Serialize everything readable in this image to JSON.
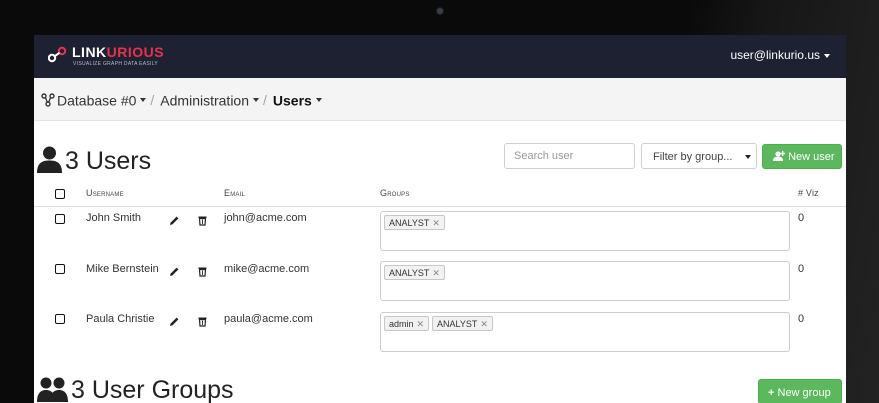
{
  "app": {
    "logo_main": "LINK",
    "logo_accent": "URIOUS",
    "logo_tagline": "VISUALIZE GRAPH DATA EASILY",
    "user_email": "user@linkurio.us"
  },
  "breadcrumb": {
    "database": "Database #0",
    "section": "Administration",
    "page": "Users",
    "separator": "/"
  },
  "users_section": {
    "title": "3 Users",
    "search_placeholder": "Search user",
    "filter_label": "Filter by group...",
    "new_user_label": "New user"
  },
  "table": {
    "headers": {
      "username": "Username",
      "email": "Email",
      "groups": "Groups",
      "viz": "# Viz"
    },
    "rows": [
      {
        "username": "John Smith",
        "email": "john@acme.com",
        "groups": [
          "ANALYST"
        ],
        "viz": "0"
      },
      {
        "username": "Mike Bernstein",
        "email": "mike@acme.com",
        "groups": [
          "ANALYST"
        ],
        "viz": "0"
      },
      {
        "username": "Paula Christie",
        "email": "paula@acme.com",
        "groups": [
          "admin",
          "ANALYST"
        ],
        "viz": "0"
      }
    ]
  },
  "groups_section": {
    "title": "3 User Groups",
    "new_group_label": "New group"
  },
  "colors": {
    "topbar": "#1e2132",
    "brand_accent": "#e5334e",
    "green_button": "#5cb85c",
    "breadcrumb_bg": "#f4f4f4"
  }
}
